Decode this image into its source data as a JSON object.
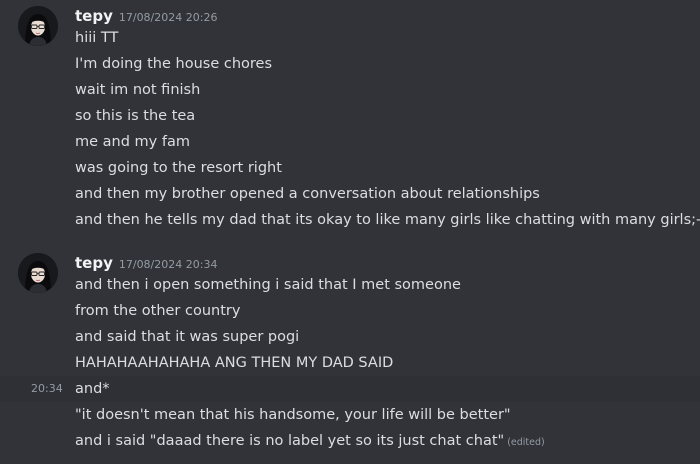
{
  "groups": [
    {
      "username": "tepy",
      "timestamp": "17/08/2024 20:26",
      "messages": [
        "hiii TT",
        "I'm doing the house chores",
        "wait im not finish",
        "so this is the tea",
        "me and my fam",
        "was going to the resort right",
        "and then my brother opened a conversation about relationships",
        "and then he tells my dad that its okay to like many girls like chatting with many girls;-;"
      ]
    },
    {
      "username": "tepy",
      "timestamp": "17/08/2024 20:34",
      "messages": [
        "and then i open something i said that I met someone",
        "from the other country",
        "and said that it was super pogi",
        "HAHAHAAHAHAHA ANG THEN MY DAD SAID",
        "and*",
        "\"it doesn't mean that his handsome, your life will be better\"",
        "and i said \"daaad there is no label yet so its just chat chat\""
      ],
      "hover_time": "20:34",
      "edited_label": "(edited)"
    }
  ],
  "colors": {
    "background": "#313338",
    "hover_background": "#2e3035",
    "username": "#f2f3f5",
    "message_text": "#dbdee1",
    "muted": "#949ba4"
  }
}
